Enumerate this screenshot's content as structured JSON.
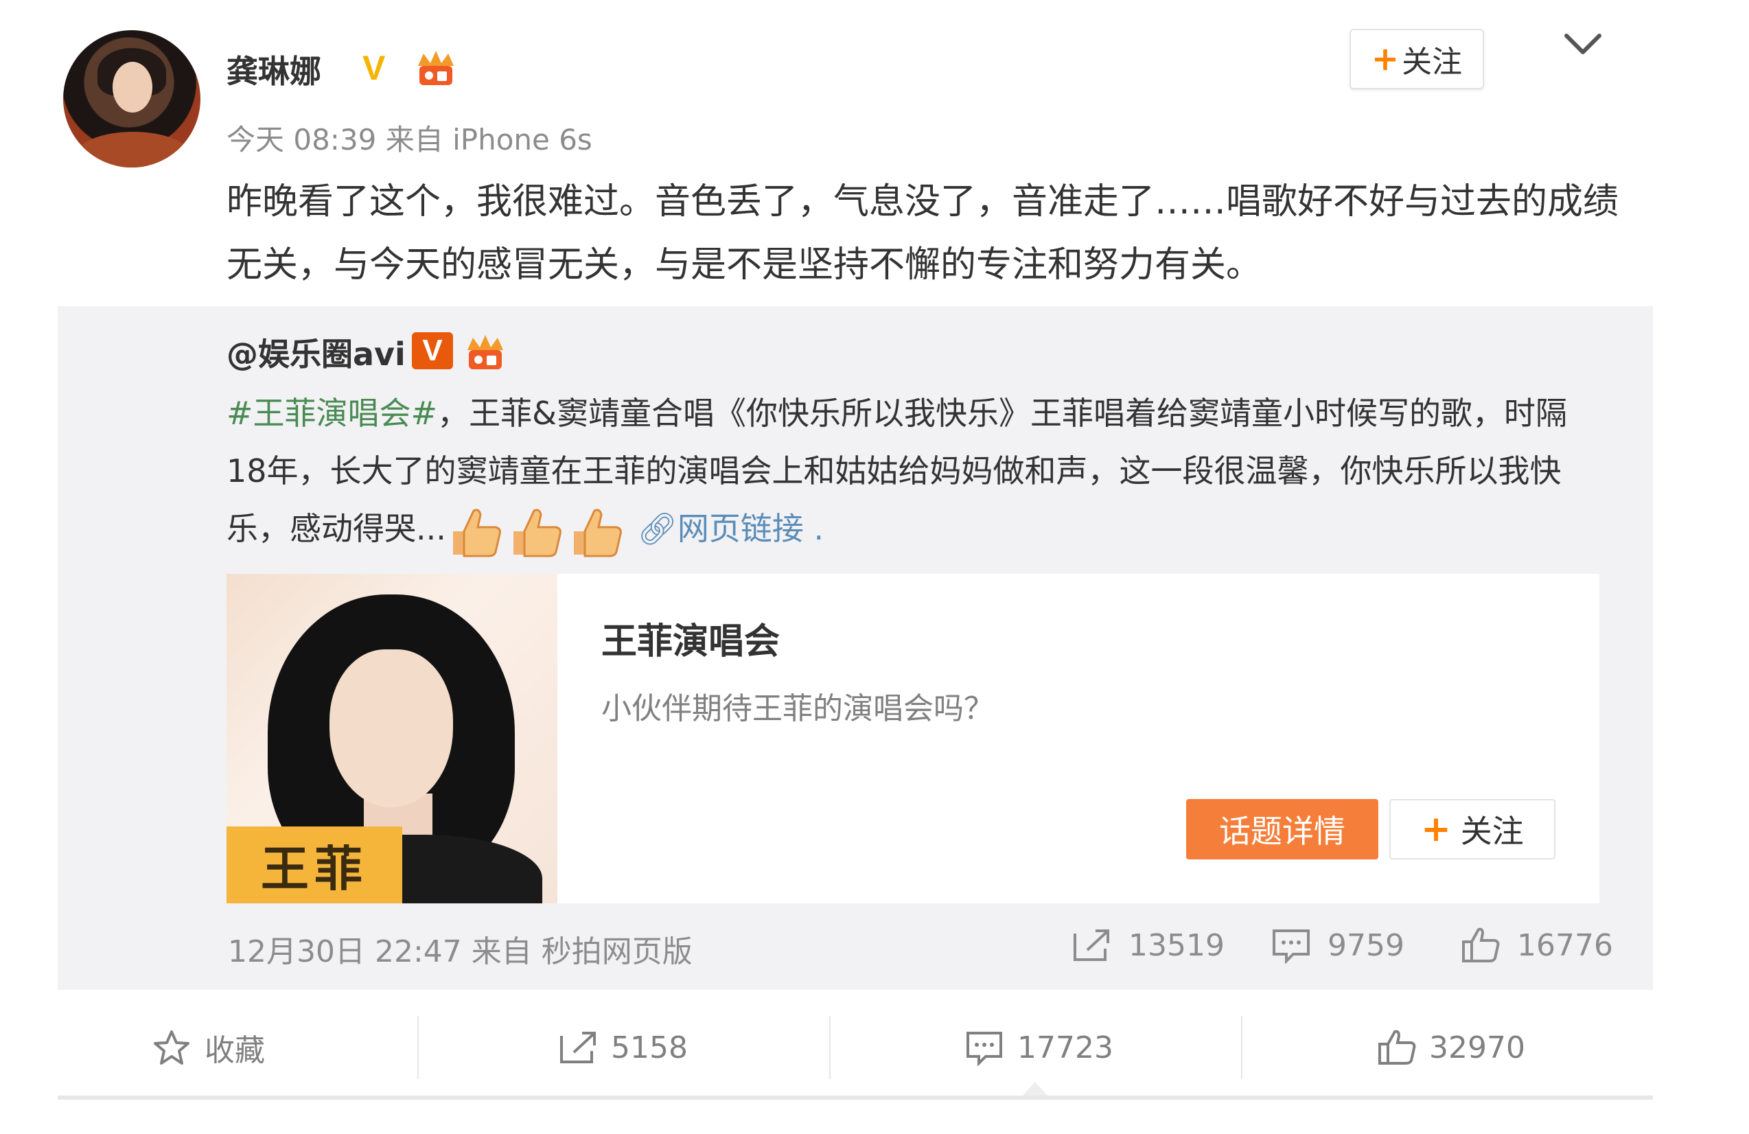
{
  "post": {
    "username": "龚琳娜",
    "v_badge": "V",
    "meta": "今天 08:39 来自 iPhone 6s",
    "follow_label": "关注",
    "text": "昨晚看了这个，我很难过。音色丢了，气息没了，音准走了……唱歌好不好与过去的成绩无关，与今天的感冒无关，与是不是坚持不懈的专注和努力有关。"
  },
  "repost": {
    "username": "@娱乐圈avi",
    "v_badge": "V",
    "hashtag": "#王菲演唱会#",
    "text": "，王菲&窦靖童合唱《你快乐所以我快乐》王菲唱着给窦靖童小时候写的歌，时隔18年，长大了的窦靖童在王菲的演唱会上和姑姑给妈妈做和声，这一段很温馨，你快乐所以我快乐，感动得哭...",
    "link_label": "网页链接",
    "card": {
      "image_tag": "王菲",
      "title": "王菲演唱会",
      "subtitle": "小伙伴期待王菲的演唱会吗？",
      "detail_button": "话题详情",
      "follow_button": "关注"
    },
    "meta": "12月30日 22:47 来自 秒拍网页版",
    "shares": "13519",
    "comments": "9759",
    "likes": "16776"
  },
  "actions": {
    "favorite": "收藏",
    "shares": "5158",
    "comments": "17723",
    "likes": "32970"
  },
  "colors": {
    "accent_orange": "#ff8200",
    "v_gold": "#f4b400",
    "v_orange": "#e8590c",
    "hashtag_green": "#4a8b53",
    "link_blue": "#5b8db8",
    "detail_btn": "#f57f3a",
    "repost_bg": "#f2f2f5"
  },
  "icons": [
    "star-icon",
    "share-icon",
    "comment-icon",
    "like-icon",
    "thumbs-up-emoji",
    "link-icon",
    "chevron-down-icon",
    "member-icon"
  ]
}
